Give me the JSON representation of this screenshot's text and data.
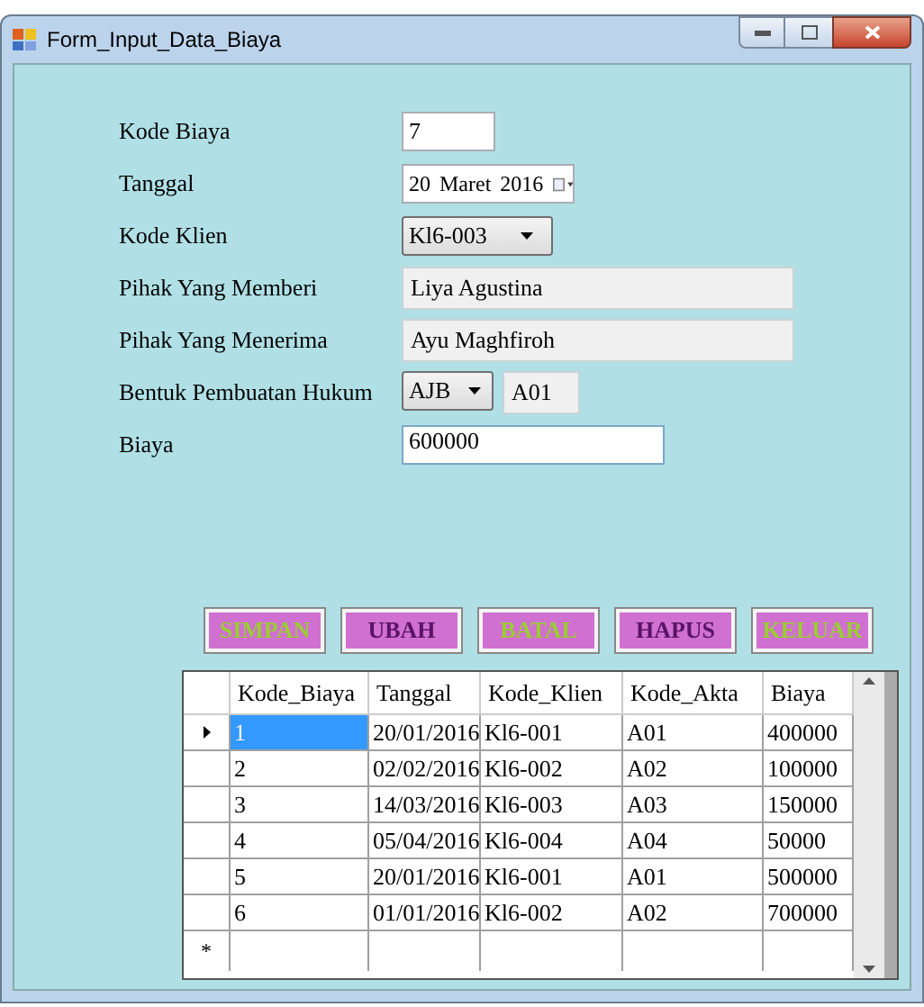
{
  "window": {
    "title": "Form_Input_Data_Biaya"
  },
  "fields": [
    {
      "label": "Kode Biaya",
      "kind": "text",
      "value": "7"
    },
    {
      "label": "Tanggal",
      "kind": "date",
      "day": "20",
      "month": "Maret",
      "year": "2016"
    },
    {
      "label": "Kode Klien",
      "kind": "combo",
      "value": "Kl6-003"
    },
    {
      "label": "Pihak Yang Memberi",
      "kind": "readonly",
      "value": "Liya Agustina"
    },
    {
      "label": "Pihak Yang Menerima",
      "kind": "readonly",
      "value": "Ayu Maghfiroh"
    },
    {
      "label": "Bentuk Pembuatan Hukum",
      "kind": "combo-code",
      "value": "AJB",
      "code": "A01"
    },
    {
      "label": "Biaya",
      "kind": "wide",
      "value": "600000"
    }
  ],
  "buttons": [
    {
      "label": "SIMPAN",
      "kind": "green"
    },
    {
      "label": "UBAH",
      "kind": "purple"
    },
    {
      "label": "BATAL",
      "kind": "green"
    },
    {
      "label": "HAPUS",
      "kind": "purple"
    },
    {
      "label": "KELUAR",
      "kind": "green"
    }
  ],
  "table": {
    "columns": [
      "Kode_Biaya",
      "Tanggal",
      "Kode_Klien",
      "Kode_Akta",
      "Biaya"
    ],
    "rows": [
      {
        "cells": [
          "1",
          "20/01/2016",
          "Kl6-001",
          "A01",
          "400000"
        ],
        "selected": true
      },
      {
        "cells": [
          "2",
          "02/02/2016",
          "Kl6-002",
          "A02",
          "100000"
        ],
        "selected": false
      },
      {
        "cells": [
          "3",
          "14/03/2016",
          "Kl6-003",
          "A03",
          "150000"
        ],
        "selected": false
      },
      {
        "cells": [
          "4",
          "05/04/2016",
          "Kl6-004",
          "A04",
          "50000"
        ],
        "selected": false
      },
      {
        "cells": [
          "5",
          "20/01/2016",
          "Kl6-001",
          "A01",
          "500000"
        ],
        "selected": false
      },
      {
        "cells": [
          "6",
          "01/01/2016",
          "Kl6-002",
          "A02",
          "700000"
        ],
        "selected": false
      }
    ],
    "new_row_marker": "*"
  }
}
